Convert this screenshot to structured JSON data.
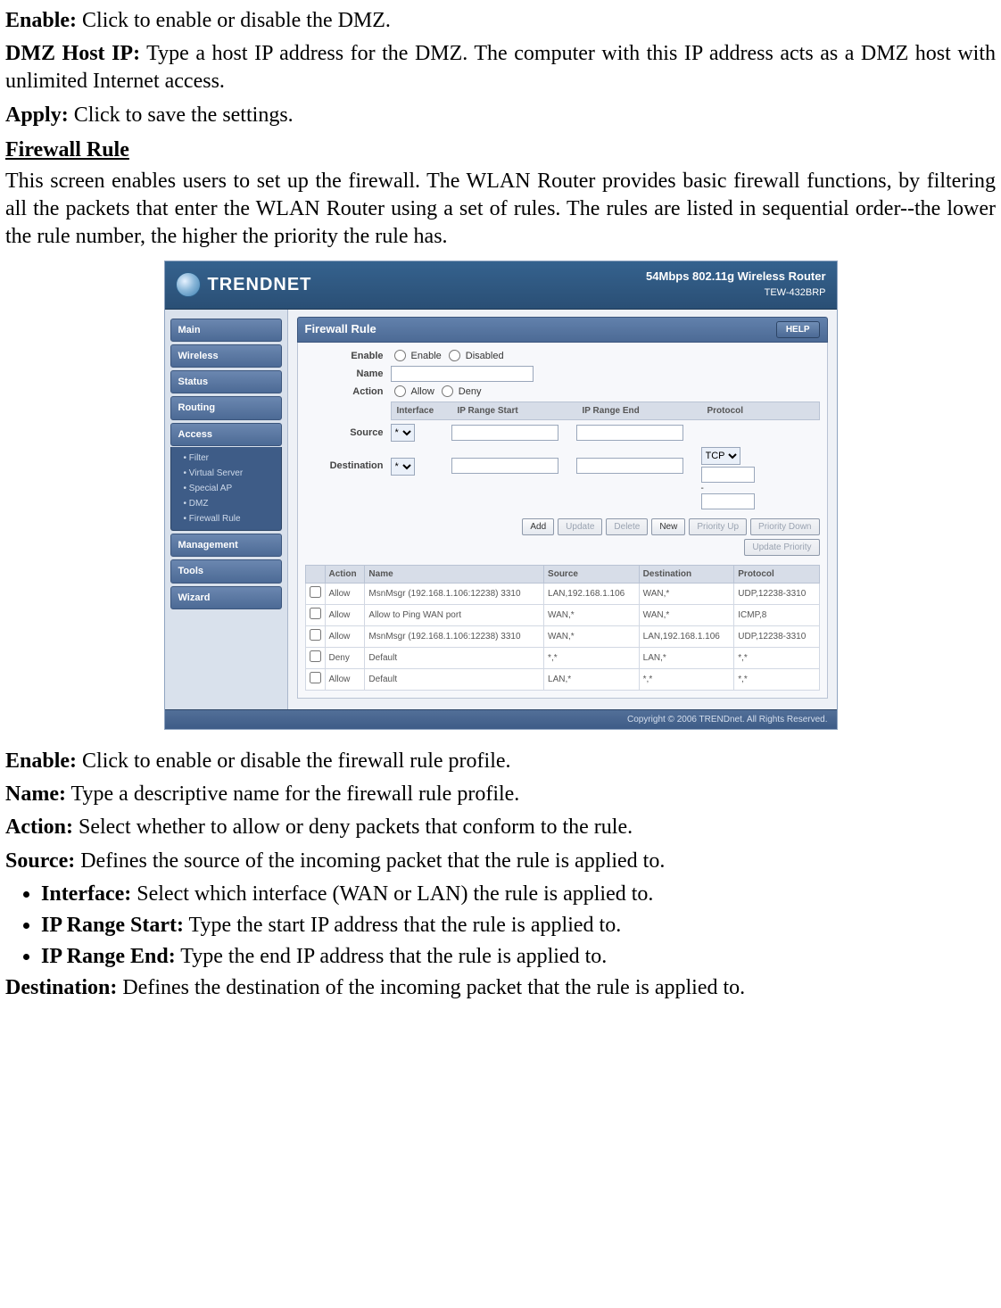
{
  "doc": {
    "p1": {
      "label": "Enable:",
      "text": " Click to enable or disable the DMZ."
    },
    "p2": {
      "label": "DMZ Host IP:",
      "text": " Type a host IP address for the DMZ. The computer with this IP address acts as a DMZ host with unlimited Internet access."
    },
    "p3": {
      "label": "Apply:",
      "text": " Click to save the settings."
    },
    "section": "Firewall Rule",
    "intro": "This screen enables users to set up the firewall. The WLAN Router provides basic firewall functions, by filtering all the packets that enter the WLAN Router using a set of rules. The rules are listed in sequential order--the lower the rule number, the higher the priority the rule has.",
    "p_enable": {
      "label": "Enable:",
      "text": " Click to enable or disable the firewall rule profile."
    },
    "p_name": {
      "label": "Name:",
      "text": " Type a descriptive name for the firewall rule profile."
    },
    "p_action": {
      "label": "Action:",
      "text": " Select whether to allow or deny packets that conform to the rule."
    },
    "p_source": {
      "label": "Source:",
      "text": " Defines the source of the incoming packet that the rule is applied to."
    },
    "bullets": {
      "b1": {
        "label": "Interface:",
        "text": " Select which interface (WAN or LAN) the rule is applied to."
      },
      "b2": {
        "label": "IP Range Start:",
        "text": " Type the start IP address that the rule is applied to."
      },
      "b3": {
        "label": "IP Range End:",
        "text": " Type the end IP address that the rule is applied to."
      }
    },
    "p_dest": {
      "label": "Destination:",
      "text": " Defines the destination of the incoming packet that the rule is applied to."
    }
  },
  "router": {
    "brand": "TRENDNET",
    "tagline": "54Mbps 802.11g Wireless Router",
    "model": "TEW-432BRP",
    "footer": "Copyright © 2006 TRENDnet. All Rights Reserved.",
    "help": "HELP",
    "nav": {
      "main": "Main",
      "wireless": "Wireless",
      "status": "Status",
      "routing": "Routing",
      "access": "Access",
      "sub": {
        "filter": "Filter",
        "vs": "Virtual Server",
        "sp": "Special AP",
        "dmz": "DMZ",
        "fw": "Firewall Rule"
      },
      "management": "Management",
      "tools": "Tools",
      "wizard": "Wizard"
    },
    "panel_title": "Firewall Rule",
    "form": {
      "enable_label": "Enable",
      "enable_opt1": "Enable",
      "enable_opt2": "Disabled",
      "name_label": "Name",
      "action_label": "Action",
      "action_opt1": "Allow",
      "action_opt2": "Deny",
      "head_if": "Interface",
      "head_start": "IP Range Start",
      "head_end": "IP Range End",
      "head_proto": "Protocol",
      "source_label": "Source",
      "dest_label": "Destination",
      "if_any": "*",
      "proto_tcp": "TCP",
      "buttons": {
        "add": "Add",
        "update": "Update",
        "delete": "Delete",
        "new": "New",
        "pu": "Priority Up",
        "pd": "Priority Down",
        "up": "Update Priority"
      }
    },
    "table": {
      "h_action": "Action",
      "h_name": "Name",
      "h_src": "Source",
      "h_dst": "Destination",
      "h_proto": "Protocol",
      "rows": [
        {
          "action": "Allow",
          "name": "MsnMsgr (192.168.1.106:12238) 3310",
          "src": "LAN,192.168.1.106",
          "dst": "WAN,*",
          "proto": "UDP,12238-3310"
        },
        {
          "action": "Allow",
          "name": "Allow to Ping WAN port",
          "src": "WAN,*",
          "dst": "WAN,*",
          "proto": "ICMP,8"
        },
        {
          "action": "Allow",
          "name": "MsnMsgr (192.168.1.106:12238) 3310",
          "src": "WAN,*",
          "dst": "LAN,192.168.1.106",
          "proto": "UDP,12238-3310"
        },
        {
          "action": "Deny",
          "name": "Default",
          "src": "*,*",
          "dst": "LAN,*",
          "proto": "*,*"
        },
        {
          "action": "Allow",
          "name": "Default",
          "src": "LAN,*",
          "dst": "*,*",
          "proto": "*,*"
        }
      ]
    }
  }
}
